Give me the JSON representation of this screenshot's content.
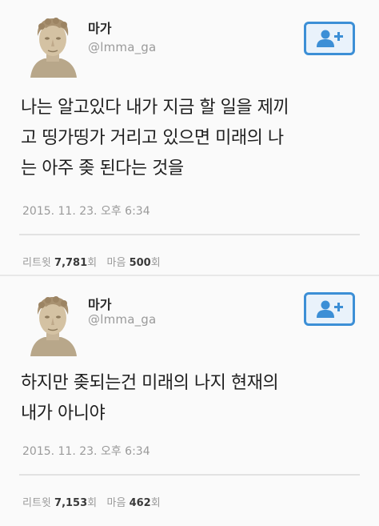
{
  "tweets": [
    {
      "display_name": "마가",
      "handle": "@lmma_ga",
      "text_lines": [
        "나는 알고있다 내가 지금 할 일을 제끼",
        "고 띵가띵가 거리고 있으면 미래의 나",
        "는 아주 좆 된다는 것을"
      ],
      "timestamp": "2015. 11. 23. 오후 6:34",
      "retweets_label": "리트윗",
      "retweets": "7,781",
      "likes_label": "마음",
      "likes": "500",
      "likes_suffix": "회",
      "retweets_suffix": "회",
      "follow_icon": "add-user-icon"
    },
    {
      "display_name": "마가",
      "handle": "@lmma_ga",
      "text_lines": [
        "하지만 좆되는건 미래의 나지 현재의",
        "내가 아니야"
      ],
      "timestamp": "2015. 11. 23. 오후 6:34",
      "retweets_label": "리트윗",
      "retweets": "7,153",
      "likes_label": "마음",
      "likes": "462",
      "likes_suffix": "회",
      "retweets_suffix": "회",
      "follow_icon": "add-user-icon"
    }
  ],
  "colors": {
    "accent": "#3c8fd6",
    "muted": "#9a9a9a",
    "text": "#1f1f1f"
  }
}
